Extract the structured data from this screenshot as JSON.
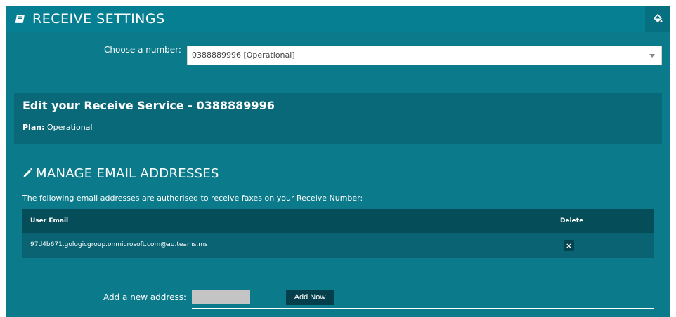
{
  "header": {
    "title": "RECEIVE SETTINGS",
    "icon": "book-icon",
    "action_icon": "paint-bucket-icon"
  },
  "number_select": {
    "label": "Choose a number:",
    "selected": "0388889996 [Operational]"
  },
  "edit_service": {
    "title": "Edit your Receive Service - 0388889996",
    "plan_label": "Plan:",
    "plan_value": "Operational"
  },
  "manage_emails": {
    "title": "MANAGE EMAIL ADDRESSES",
    "icon": "pencil-icon",
    "description": "The following email addresses are authorised to receive faxes on your Receive Number:",
    "columns": [
      "User Email",
      "Delete"
    ],
    "rows": [
      {
        "email": "97d4b671.gologicgroup.onmicrosoft.com@au.teams.ms",
        "delete_glyph": "×"
      }
    ]
  },
  "add_address": {
    "label": "Add a new address:",
    "input_value": "",
    "button_label": "Add Now"
  },
  "colors": {
    "panel_bg": "#0b7a8b",
    "header_bg": "#077f93",
    "table_head_bg": "#064d5a",
    "button_bg": "#053f4b"
  }
}
